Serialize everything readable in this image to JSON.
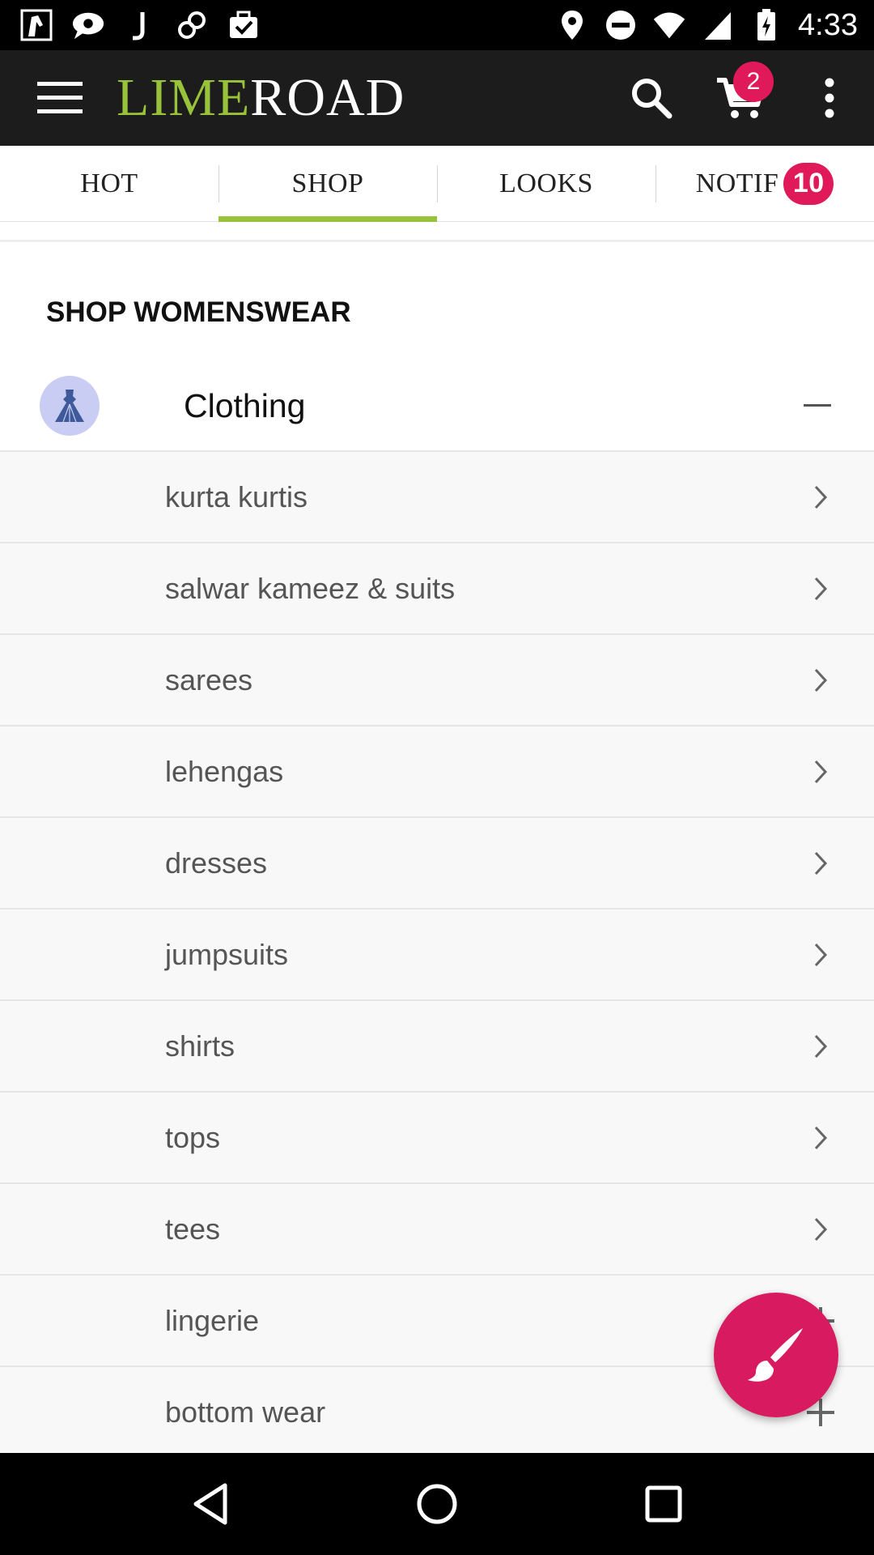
{
  "status_bar": {
    "time": "4:33",
    "left_icons": [
      "photo-notification-icon",
      "chat-notification-icon",
      "j-app-icon",
      "link-app-icon",
      "briefcase-check-icon"
    ],
    "right_icons": [
      "location-icon",
      "do-not-disturb-icon",
      "wifi-icon",
      "cell-signal-icon",
      "battery-charging-icon"
    ]
  },
  "app_bar": {
    "logo_lime": "LIME",
    "logo_road": "ROAD",
    "cart_count": "2",
    "icons": [
      "menu-icon",
      "search-icon",
      "cart-icon",
      "more-vert-icon"
    ]
  },
  "tabs": [
    {
      "label": "HOT",
      "active": false
    },
    {
      "label": "SHOP",
      "active": true
    },
    {
      "label": "LOOKS",
      "active": false
    },
    {
      "label": "NOTIF",
      "active": false,
      "badge": "10"
    }
  ],
  "main": {
    "section_title": "SHOP WOMENSWEAR",
    "category": {
      "label": "Clothing",
      "expanded": true,
      "icon": "dress-icon"
    },
    "subcategories": [
      {
        "label": "kurta kurtis",
        "icon": "chevron-right"
      },
      {
        "label": "salwar kameez & suits",
        "icon": "chevron-right"
      },
      {
        "label": "sarees",
        "icon": "chevron-right"
      },
      {
        "label": "lehengas",
        "icon": "chevron-right"
      },
      {
        "label": "dresses",
        "icon": "chevron-right"
      },
      {
        "label": "jumpsuits",
        "icon": "chevron-right"
      },
      {
        "label": "shirts",
        "icon": "chevron-right"
      },
      {
        "label": "tops",
        "icon": "chevron-right"
      },
      {
        "label": "tees",
        "icon": "chevron-right"
      },
      {
        "label": "lingerie",
        "icon": "plus"
      },
      {
        "label": "bottom wear",
        "icon": "plus"
      }
    ]
  },
  "fab": {
    "icon": "paintbrush-icon"
  },
  "colors": {
    "brand_lime": "#99c23b",
    "accent_pink": "#e0195a",
    "app_bar_bg": "#1c1c1c"
  }
}
